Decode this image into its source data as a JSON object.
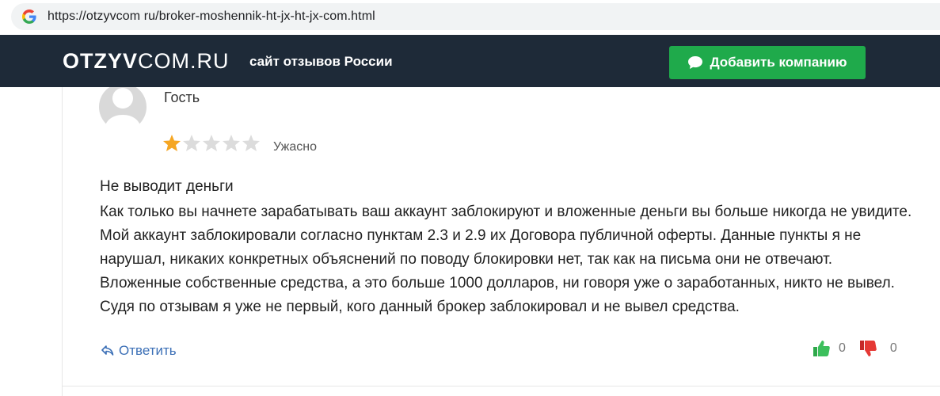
{
  "browser": {
    "url": "https://otzyvcom ru/broker-moshennik-ht-jx-ht-jx-com.html"
  },
  "header": {
    "logo_bold": "OTZYV",
    "logo_thin": "COM.RU",
    "tagline": "сайт отзывов России",
    "add_button_label": "Добавить компанию",
    "colors": {
      "header_bg": "#1e2a38",
      "button_bg": "#1faa4b"
    }
  },
  "review": {
    "author": "Гость",
    "rating": 1,
    "rating_max": 5,
    "rating_label": "Ужасно",
    "title": "Не выводит деньги",
    "body": "Как только вы начнете зарабатывать ваш аккаунт заблокируют и вложенные деньги вы больше никогда не увидите. Мой аккаунт заблокировали согласно пунктам 2.3 и 2.9 их Договора публичной оферты. Данные пункты я не нарушал, никаких конкретных объяснений по поводу блокировки нет, так как на письма они не отвечают. Вложенные собственные средства, а это больше 1000 долларов, ни говоря уже о заработанных, никто не вывел. Судя по отзывам я уже не первый, кого данный брокер заблокировал и не вывел средства.",
    "reply_label": "Ответить",
    "likes": "0",
    "dislikes": "0",
    "icons": {
      "reply": "reply-arrow-icon",
      "like": "thumbs-up-icon",
      "dislike": "thumbs-down-icon"
    }
  }
}
